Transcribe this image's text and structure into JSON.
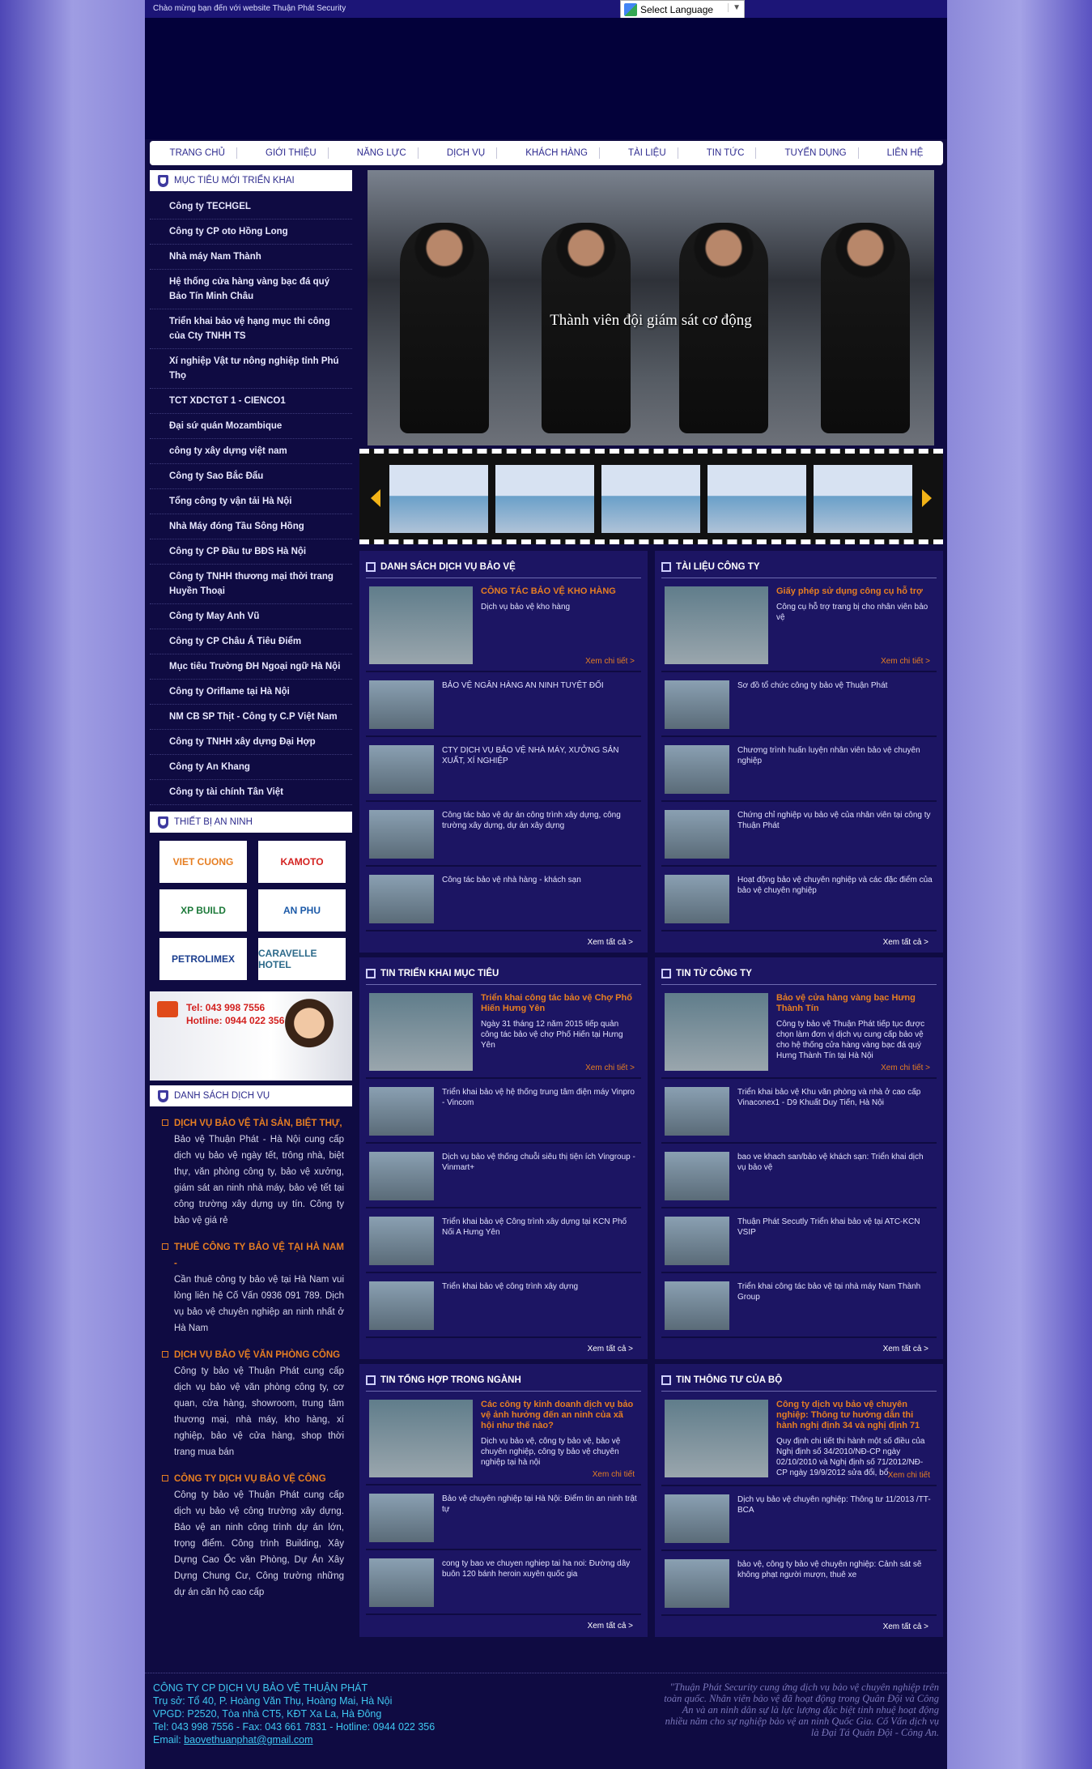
{
  "topbar": {
    "welcome": "Chào mừng bạn đến với website Thuận Phát Security",
    "language": "Select Language"
  },
  "nav": [
    "TRANG CHỦ",
    "GIỚI THIỆU",
    "NĂNG LỰC",
    "DỊCH VỤ",
    "KHÁCH HÀNG",
    "TÀI LIỆU",
    "TIN TỨC",
    "TUYỂN DỤNG",
    "LIÊN HỆ"
  ],
  "targets": {
    "title": "MỤC TIÊU MỚI TRIỂN KHAI",
    "items": [
      "Công ty TECHGEL",
      "Công ty CP oto Hồng Long",
      "Nhà máy Nam Thành",
      "Hệ thống cửa hàng vàng bạc đá quý Bảo Tín Minh Châu",
      "Triển khai bảo vệ hạng mục thi công của Cty TNHH TS",
      "Xí nghiệp Vật tư nông nghiệp tỉnh Phú Thọ",
      "TCT XDCTGT 1 - CIENCO1",
      "Đại sứ quán Mozambique",
      "công ty xây dựng việt nam",
      "Công ty Sao Bắc Đẩu",
      "Tổng công ty vận tải Hà Nội",
      "Nhà Máy đóng Tầu Sông Hồng",
      "Công ty CP Đầu tư BĐS Hà Nội",
      "Công ty TNHH thương mại thời trang Huyền Thoại",
      "Công ty May Anh Vũ",
      "Công ty CP Châu Á Tiêu Điểm",
      "Mục tiêu Trường ĐH Ngoại ngữ Hà Nội",
      "Công ty Oriflame tại Hà Nội",
      "NM CB SP Thịt - Công ty C.P Việt Nam",
      "Công ty TNHH xây dựng Đại Hợp",
      "Công ty An Khang",
      "Công ty tài chính Tân Việt"
    ]
  },
  "devices": {
    "title": "THIẾT BỊ AN NINH",
    "logos": [
      {
        "text": "VIET CUONG",
        "color": "#e67e22"
      },
      {
        "text": "KAMOTO",
        "color": "#d3211f"
      },
      {
        "text": "XP BUILD",
        "color": "#1d7a3a"
      },
      {
        "text": "AN PHU",
        "color": "#1c5aa8"
      },
      {
        "text": "PETROLIMEX",
        "color": "#1c3f8f"
      },
      {
        "text": "CARAVELLE HOTEL",
        "color": "#2c6a8a"
      }
    ]
  },
  "hotline": {
    "tel": "Tel: 043 998 7556",
    "hotline": "Hotline: 0944 022 356"
  },
  "services": {
    "title": "DANH SÁCH DỊCH VỤ",
    "items": [
      {
        "head": "Dịch vụ Bảo Vệ Tài Sản, Biệt Thự,",
        "body": "Bảo vệ Thuận Phát - Hà Nội cung cấp dịch vụ bảo vệ ngày tết, trông nhà, biệt thự, văn phòng công ty, bảo vệ xưởng, giám sát an ninh nhà máy, bảo vệ tết tại công trường xây dựng uy tín. Công ty bảo vệ giá rẻ"
      },
      {
        "head": "THUÊ CÔNG TY BẢO VỆ TẠI HÀ NAM -",
        "body": "Cần thuê công ty bảo vệ tại Hà Nam vui lòng liên hệ Cố Vấn 0936 091 789. Dịch vụ bảo vệ chuyên nghiệp an ninh nhất ở Hà Nam"
      },
      {
        "head": "DỊCH VỤ BẢO VỆ VĂN PHÒNG CÔNG",
        "body": "Công ty bảo vệ Thuận Phát cung cấp dịch vụ bảo vệ văn phòng công ty, cơ quan, cửa hàng, showroom, trung tâm thương mại, nhà máy, kho hàng, xí nghiệp, bảo vệ cửa hàng, shop thời trang mua bán"
      },
      {
        "head": "CÔNG TY DỊCH VỤ BẢO VỆ CÔNG",
        "body": "Công ty bảo vệ Thuận Phát cung cấp dịch vụ bảo vệ công trường xây dựng. Bảo vệ an ninh công trình dự án lớn, trọng điểm. Công trình Building, Xây Dựng Cao Ốc văn Phòng, Dự Án Xây Dựng Chung Cư, Công trường những dự án căn hộ cao cấp"
      }
    ]
  },
  "slide": {
    "caption": "Thành viên đội giám sát cơ động"
  },
  "panels": [
    {
      "title": "DANH SÁCH DỊCH VỤ BẢO VỆ",
      "feature": {
        "title": "CÔNG TÁC BẢO VỆ KHO HÀNG",
        "text": "Dịch vụ bảo vệ kho hàng",
        "more": "Xem chi tiết >"
      },
      "rows": [
        "BẢO VỆ NGÂN HÀNG AN NINH TUYỆT ĐỐI",
        "CTY DỊCH VỤ BẢO VỆ NHÀ MÁY, XƯỞNG SẢN XUẤT, XÍ NGHIỆP",
        "Công tác bảo vệ dự án công trình xây dựng, công trường xây dựng, dự án xây dựng",
        "Công tác bảo vệ nhà hàng - khách sạn"
      ],
      "seeall": "Xem tất cả >"
    },
    {
      "title": "TÀI LIỆU CÔNG TY",
      "feature": {
        "title": "Giấy phép sử dụng công cụ hỗ trợ",
        "text": "Công cụ hỗ trợ trang bị cho nhân viên bảo vệ",
        "more": "Xem chi tiết >"
      },
      "rows": [
        "Sơ đồ tổ chức công ty bảo vệ Thuận Phát",
        "Chương trình huấn luyện nhân viên bảo vệ chuyên nghiệp",
        "Chứng chỉ nghiệp vụ bảo vệ của nhân viên tại công ty Thuận Phát",
        "Hoạt động bảo vệ chuyên nghiệp và các đặc điểm của bảo vệ chuyên nghiệp"
      ],
      "seeall": "Xem tất cả >"
    },
    {
      "title": "TIN TRIỂN KHAI MỤC TIÊU",
      "feature": {
        "title": "Triển khai công tác bảo vệ Chợ Phố Hiến Hưng Yên",
        "text": "Ngày 31 tháng 12 năm 2015 tiếp quản công tác bảo vệ chợ Phố Hiến tại Hưng Yên",
        "more": "Xem chi tiết >"
      },
      "rows": [
        "Triển khai bảo vệ hệ thống trung tâm điện máy Vinpro - Vincom",
        "Dịch vụ bảo vệ thống chuỗi siêu thị tiện ích Vingroup - Vinmart+",
        "Triển khai bảo vệ Công trình xây dựng tại KCN Phố Nối A Hưng Yên",
        "Triển khai bảo vệ công trình xây dựng"
      ],
      "seeall": "Xem tất cả >"
    },
    {
      "title": "TIN TỪ CÔNG TY",
      "feature": {
        "title": "Bảo vệ cửa hàng vàng bạc Hưng Thành Tín",
        "text": "Công ty bảo vệ Thuận Phát tiếp tục được chọn làm đơn vị dịch vụ cung cấp bảo vệ cho hệ thống cửa hàng vàng bạc đá quý Hưng Thành Tín tại Hà Nội",
        "more": "Xem chi tiết >"
      },
      "rows": [
        "Triển khai bảo vệ Khu văn phòng và nhà ở cao cấp Vinaconex1 - D9 Khuất Duy Tiến, Hà Nội",
        "bao ve khach san/bảo vệ khách sạn: Triển khai dịch vụ bảo vệ",
        "Thuận Phát Secutly Triển khai bảo vệ tại ATC-KCN VSIP",
        "Triển khai công tác bảo vệ tại nhà máy Nam Thành Group"
      ],
      "seeall": "Xem tất cả >"
    },
    {
      "title": "TIN TỔNG HỢP TRONG NGÀNH",
      "feature": {
        "title": "Các công ty kinh doanh dịch vụ bảo vệ ảnh hưởng đến an ninh của xã hội như thế nào?",
        "text": "Dịch vụ bảo vệ, công ty bảo vệ, bảo vệ chuyên nghiệp, công ty bảo vệ chuyên nghiệp tại hà nội",
        "more": "Xem chi tiết"
      },
      "rows": [
        "Bảo vệ chuyên nghiệp tại Hà Nội: Điểm tin an ninh trật tự",
        "cong ty bao ve chuyen nghiep tai ha noi: Đường dây buôn 120 bánh heroin xuyên quốc gia"
      ],
      "seeall": "Xem tất cả >"
    },
    {
      "title": "TIN THÔNG TƯ CỦA BỘ",
      "feature": {
        "title": "Công ty dịch vụ bảo vệ chuyên nghiệp: Thông tư hướng dẫn thi hành nghị định 34 và nghị định 71",
        "text": "Quy định chi tiết thi hành một số điều của Nghị định số 34/2010/NĐ-CP ngày 02/10/2010 và Nghị định số 71/2012/NĐ-CP ngày 19/9/2012 sửa đổi, bổ",
        "more": "Xem chi tiết"
      },
      "rows": [
        "Dịch vụ bảo vệ chuyên nghiệp: Thông tư 11/2013 /TT-BCA",
        "bảo vệ, công ty bảo vệ chuyên nghiệp: Cảnh sát sẽ không phạt người mượn, thuê xe"
      ],
      "seeall": "Xem tất cả >"
    }
  ],
  "footer": {
    "name": "CÔNG TY CP DỊCH VỤ BẢO VỆ THUẬN PHÁT",
    "hq": "Trụ sở: Tổ 40, P. Hoàng Văn Thụ, Hoàng Mai, Hà Nội",
    "office": "VPGD: P2520, Tòa nhà CT5, KĐT Xa La, Hà Đông",
    "phones": "Tel: 043 998 7556 - Fax: 043 661 7831 - Hotline: 0944 022 356",
    "email_label": "Email:",
    "email": "baovethuanphat@gmail.com",
    "quote": "\"Thuận Phát Security cung ứng dịch vụ bảo vệ chuyên nghiệp trên toàn quốc. Nhân viên bảo vệ đã hoạt động trong Quân Đội và Công An và an ninh dân sự là lực lượng đặc biệt tinh nhuệ hoạt động nhiều năm cho sự nghiệp bảo vệ an ninh Quốc Gia. Cố Vấn dịch vụ là Đại Tá Quân Đội - Công An."
  }
}
